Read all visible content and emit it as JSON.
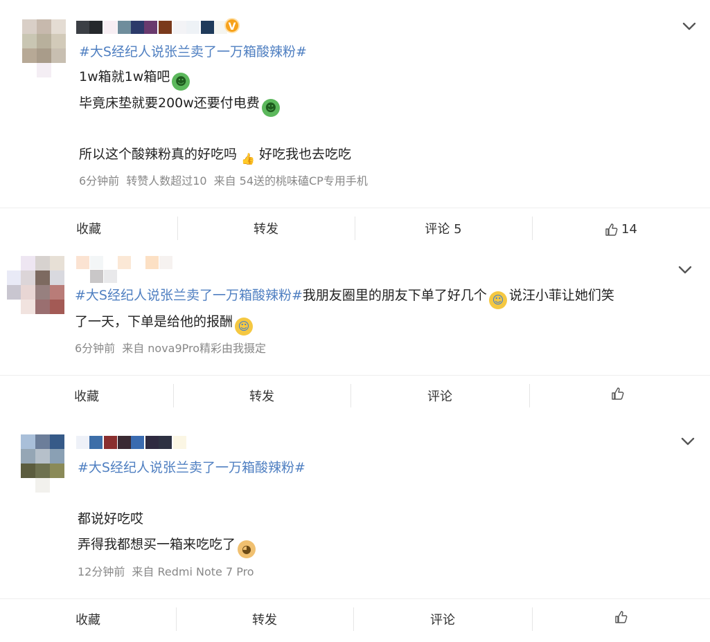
{
  "posts": [
    {
      "topic": "#大S经纪人说张兰卖了一万箱酸辣粉#",
      "lines": [
        "1w箱就1w箱吧",
        "毕竟床垫就要200w还要付电费",
        "所以这个酸辣粉真的好吃吗",
        "好吃我也去吃吃"
      ],
      "time": "6分钟前",
      "extra": "转赞人数超过10",
      "source": "来自 54送的桃味磕CP专用手机",
      "actions": {
        "fav": "收藏",
        "repost": "转发",
        "comment": "评论 5",
        "likes": "14"
      },
      "verified_badge": "V",
      "emojis": [
        "frog",
        "frog",
        "thumb"
      ]
    },
    {
      "topic": "#大S经纪人说张兰卖了一万箱酸辣粉#",
      "text1": "我朋友圈里的朋友下单了好几个",
      "text2": "说汪小菲让她们笑",
      "text3": "了一天，下单是给他的报酬",
      "time": "6分钟前",
      "source": "来自 nova9Pro精彩由我摄定",
      "actions": {
        "fav": "收藏",
        "repost": "转发",
        "comment": "评论"
      },
      "emojis": [
        "laugh-cry",
        "laugh-cry"
      ]
    },
    {
      "topic": "#大S经纪人说张兰卖了一万箱酸辣粉#",
      "lines": [
        "都说好吃哎",
        "弄得我都想买一箱来吃吃了"
      ],
      "time": "12分钟前",
      "source": "来自 Redmi Note 7 Pro",
      "actions": {
        "fav": "收藏",
        "repost": "转发",
        "comment": "评论"
      },
      "emojis": [
        "doge"
      ]
    }
  ],
  "colors": {
    "topic": "#4f7fc1",
    "meta": "#888888",
    "text": "#222222",
    "divider": "#eeeeee"
  }
}
